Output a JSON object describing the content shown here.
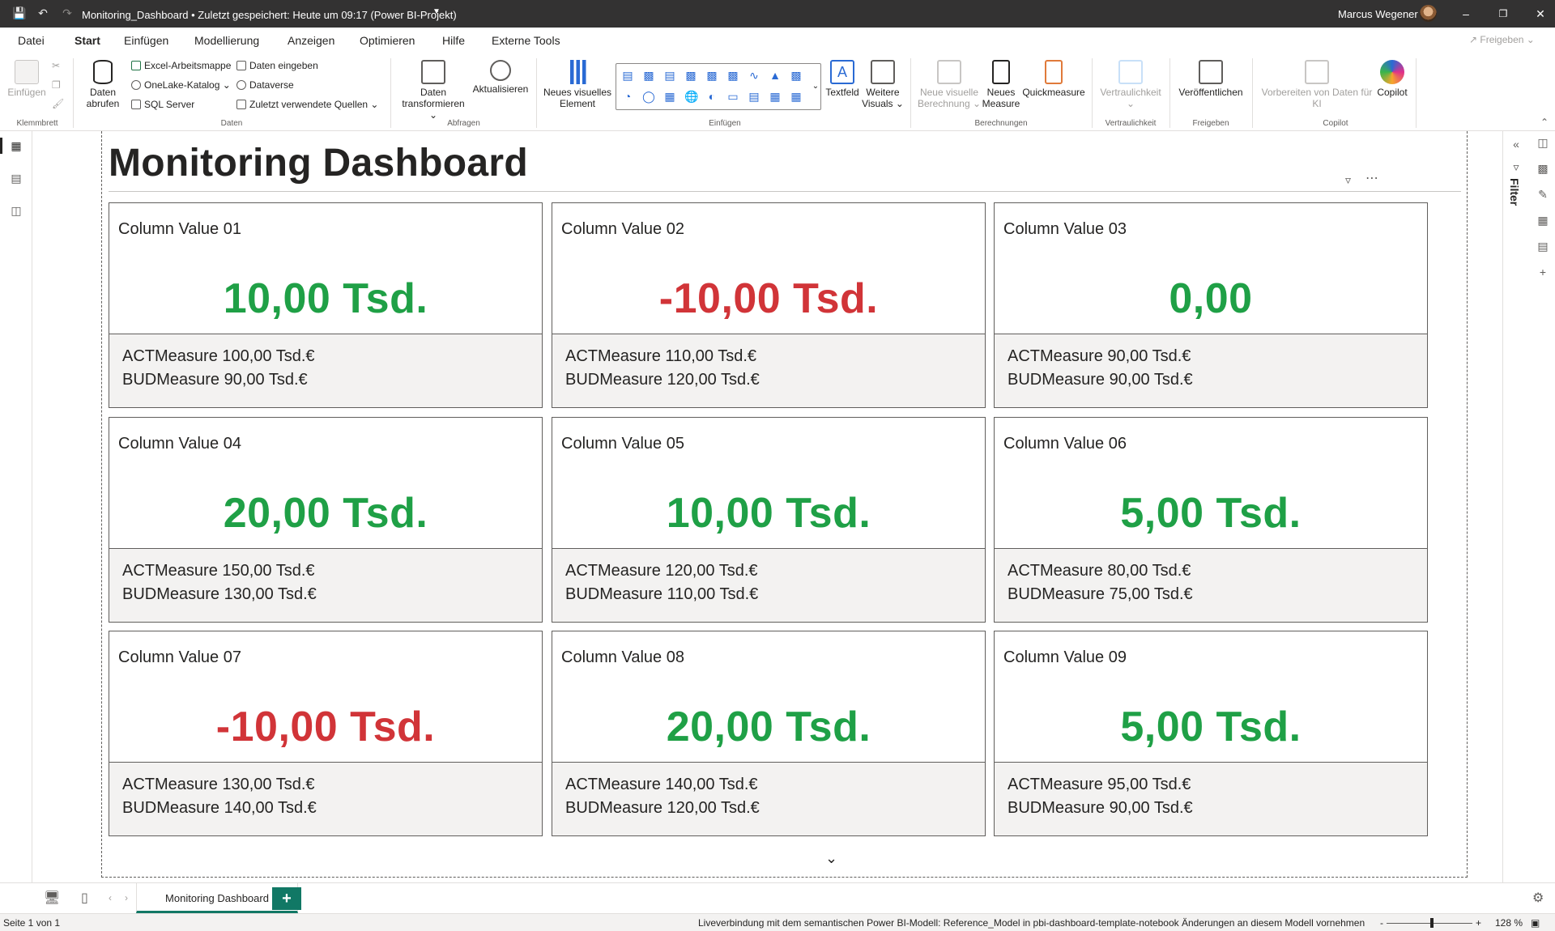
{
  "titlebar": {
    "title": "Monitoring_Dashboard • Zuletzt gespeichert: Heute um 09:17 (Power BI-Projekt)",
    "user": "Marcus Wegener",
    "icons": [
      "save-icon",
      "undo-icon",
      "redo-icon",
      "chevron-down-icon",
      "minimize-icon",
      "restore-icon",
      "close-icon"
    ]
  },
  "menu": {
    "tabs": [
      "Datei",
      "Start",
      "Einfügen",
      "Modellierung",
      "Anzeigen",
      "Optimieren",
      "Hilfe",
      "Externe Tools"
    ],
    "active": "Start",
    "share": "Freigeben"
  },
  "ribbon": {
    "paste": "Einfügen",
    "get_data": "Daten abrufen",
    "excel": "Excel-Arbeitsmappe",
    "onelake": "OneLake-Katalog",
    "sql": "SQL Server",
    "enter_data": "Daten eingeben",
    "dataverse": "Dataverse",
    "recent": "Zuletzt verwendete Quellen",
    "transform": "Daten transformieren",
    "refresh": "Aktualisieren",
    "new_visual": "Neues visuelles Element",
    "textbox": "Textfeld",
    "more_visuals": "Weitere Visuals",
    "new_visual_calc": "Neue visuelle Berechnung",
    "new_measure": "Neues Measure",
    "quick_measure": "Quickmeasure",
    "sensitivity": "Vertraulichkeit",
    "publish": "Veröffentlichen",
    "prepare_ai": "Vorbereiten von Daten für KI",
    "copilot": "Copilot",
    "groups": {
      "clipboard": "Klemmbrett",
      "data": "Daten",
      "queries": "Abfragen",
      "insert": "Einfügen",
      "calculations": "Berechnungen",
      "sensitivity": "Vertraulichkeit",
      "share": "Freigeben",
      "copilot": "Copilot"
    }
  },
  "right_pane": {
    "filter_label": "Filter"
  },
  "page": {
    "title": "Monitoring Dashboard",
    "positive_color": "#1fa046",
    "negative_color": "#d13438"
  },
  "cards": [
    {
      "name": "Column Value 01",
      "value": "10,00 Tsd.",
      "sign": "pos",
      "act": "ACTMeasure 100,00 Tsd.€",
      "bud": "BUDMeasure 90,00 Tsd.€"
    },
    {
      "name": "Column Value 02",
      "value": "-10,00 Tsd.",
      "sign": "neg",
      "act": "ACTMeasure 110,00 Tsd.€",
      "bud": "BUDMeasure 120,00 Tsd.€"
    },
    {
      "name": "Column Value 03",
      "value": "0,00",
      "sign": "pos",
      "act": "ACTMeasure 90,00 Tsd.€",
      "bud": "BUDMeasure 90,00 Tsd.€"
    },
    {
      "name": "Column Value 04",
      "value": "20,00 Tsd.",
      "sign": "pos",
      "act": "ACTMeasure 150,00 Tsd.€",
      "bud": "BUDMeasure 130,00 Tsd.€"
    },
    {
      "name": "Column Value 05",
      "value": "10,00 Tsd.",
      "sign": "pos",
      "act": "ACTMeasure 120,00 Tsd.€",
      "bud": "BUDMeasure 110,00 Tsd.€"
    },
    {
      "name": "Column Value 06",
      "value": "5,00 Tsd.",
      "sign": "pos",
      "act": "ACTMeasure 80,00 Tsd.€",
      "bud": "BUDMeasure 75,00 Tsd.€"
    },
    {
      "name": "Column Value 07",
      "value": "-10,00 Tsd.",
      "sign": "neg",
      "act": "ACTMeasure 130,00 Tsd.€",
      "bud": "BUDMeasure 140,00 Tsd.€"
    },
    {
      "name": "Column Value 08",
      "value": "20,00 Tsd.",
      "sign": "pos",
      "act": "ACTMeasure 140,00 Tsd.€",
      "bud": "BUDMeasure 120,00 Tsd.€"
    },
    {
      "name": "Column Value 09",
      "value": "5,00 Tsd.",
      "sign": "pos",
      "act": "ACTMeasure 95,00 Tsd.€",
      "bud": "BUDMeasure 90,00 Tsd.€"
    }
  ],
  "pagetabs": {
    "current": "Monitoring Dashboard",
    "add": "+"
  },
  "status": {
    "page": "Seite 1 von 1",
    "connection": "Liveverbindung mit dem semantischen Power BI-Modell: Reference_Model in pbi-dashboard-template-notebook Änderungen an diesem Modell vornehmen",
    "zoom": "128 %",
    "zoom_minus": "-",
    "zoom_plus": "+"
  }
}
